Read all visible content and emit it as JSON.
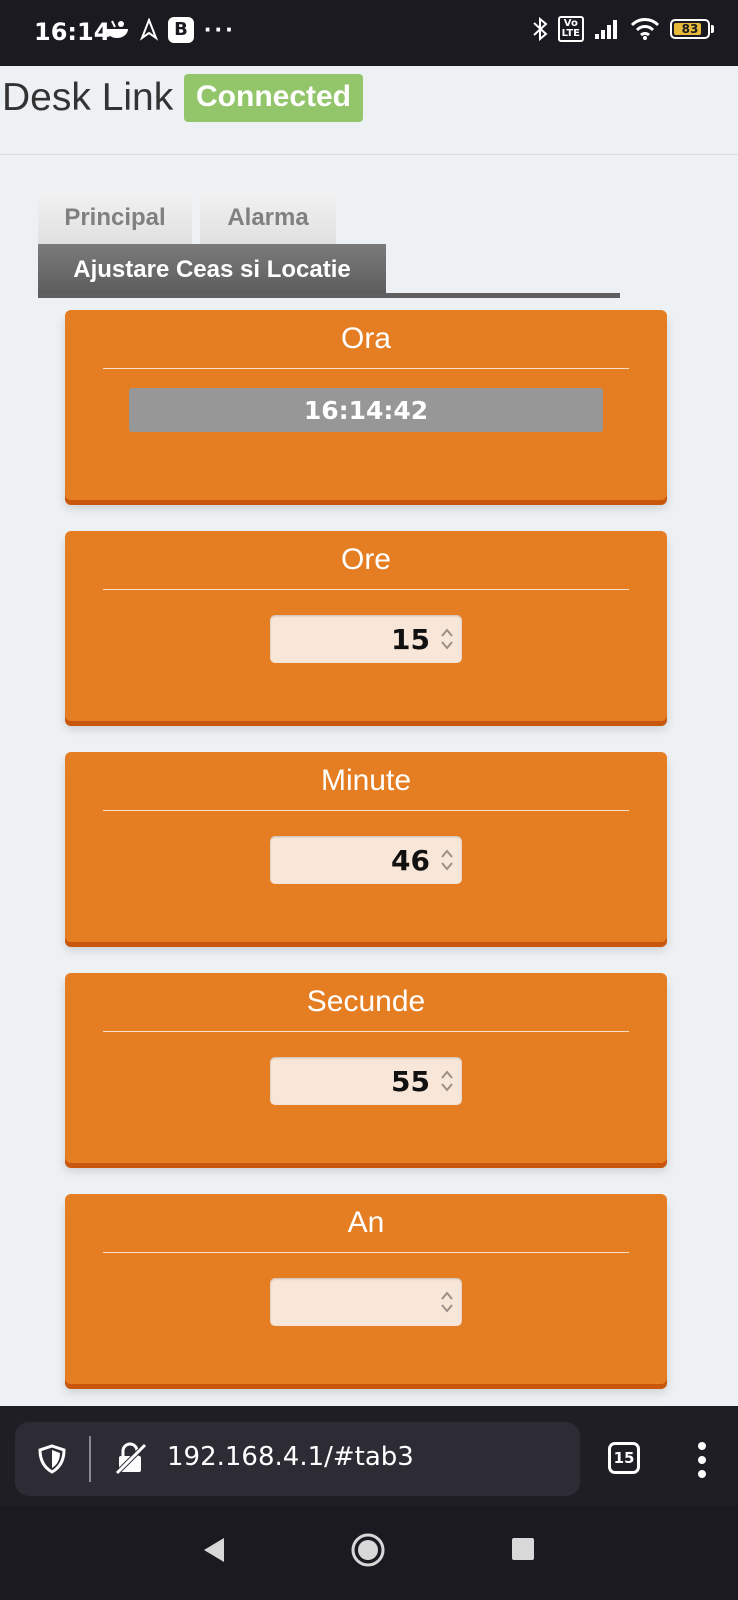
{
  "status_bar": {
    "time": "16:14",
    "more": "···",
    "volte_label": "Vo\nLTE",
    "battery": "83"
  },
  "header": {
    "title": "Desk Link",
    "connection_status": "Connected",
    "status_color": "#93c56a"
  },
  "tabs": [
    {
      "label": "Principal",
      "active": false
    },
    {
      "label": "Alarma",
      "active": false
    },
    {
      "label": "Ajustare Ceas si Locatie",
      "active": true
    }
  ],
  "cards": {
    "ora": {
      "title": "Ora",
      "value": "16:14:42"
    },
    "ore": {
      "title": "Ore",
      "value": "15"
    },
    "minute": {
      "title": "Minute",
      "value": "46"
    },
    "secunde": {
      "title": "Secunde",
      "value": "55"
    },
    "an": {
      "title": "An",
      "value": ""
    }
  },
  "browser": {
    "url": "192.168.4.1/#tab3",
    "tab_count": "15"
  },
  "colors": {
    "accent": "#e57e22",
    "card_shadow": "#c9560d",
    "input_bg": "#f8e6d8"
  }
}
